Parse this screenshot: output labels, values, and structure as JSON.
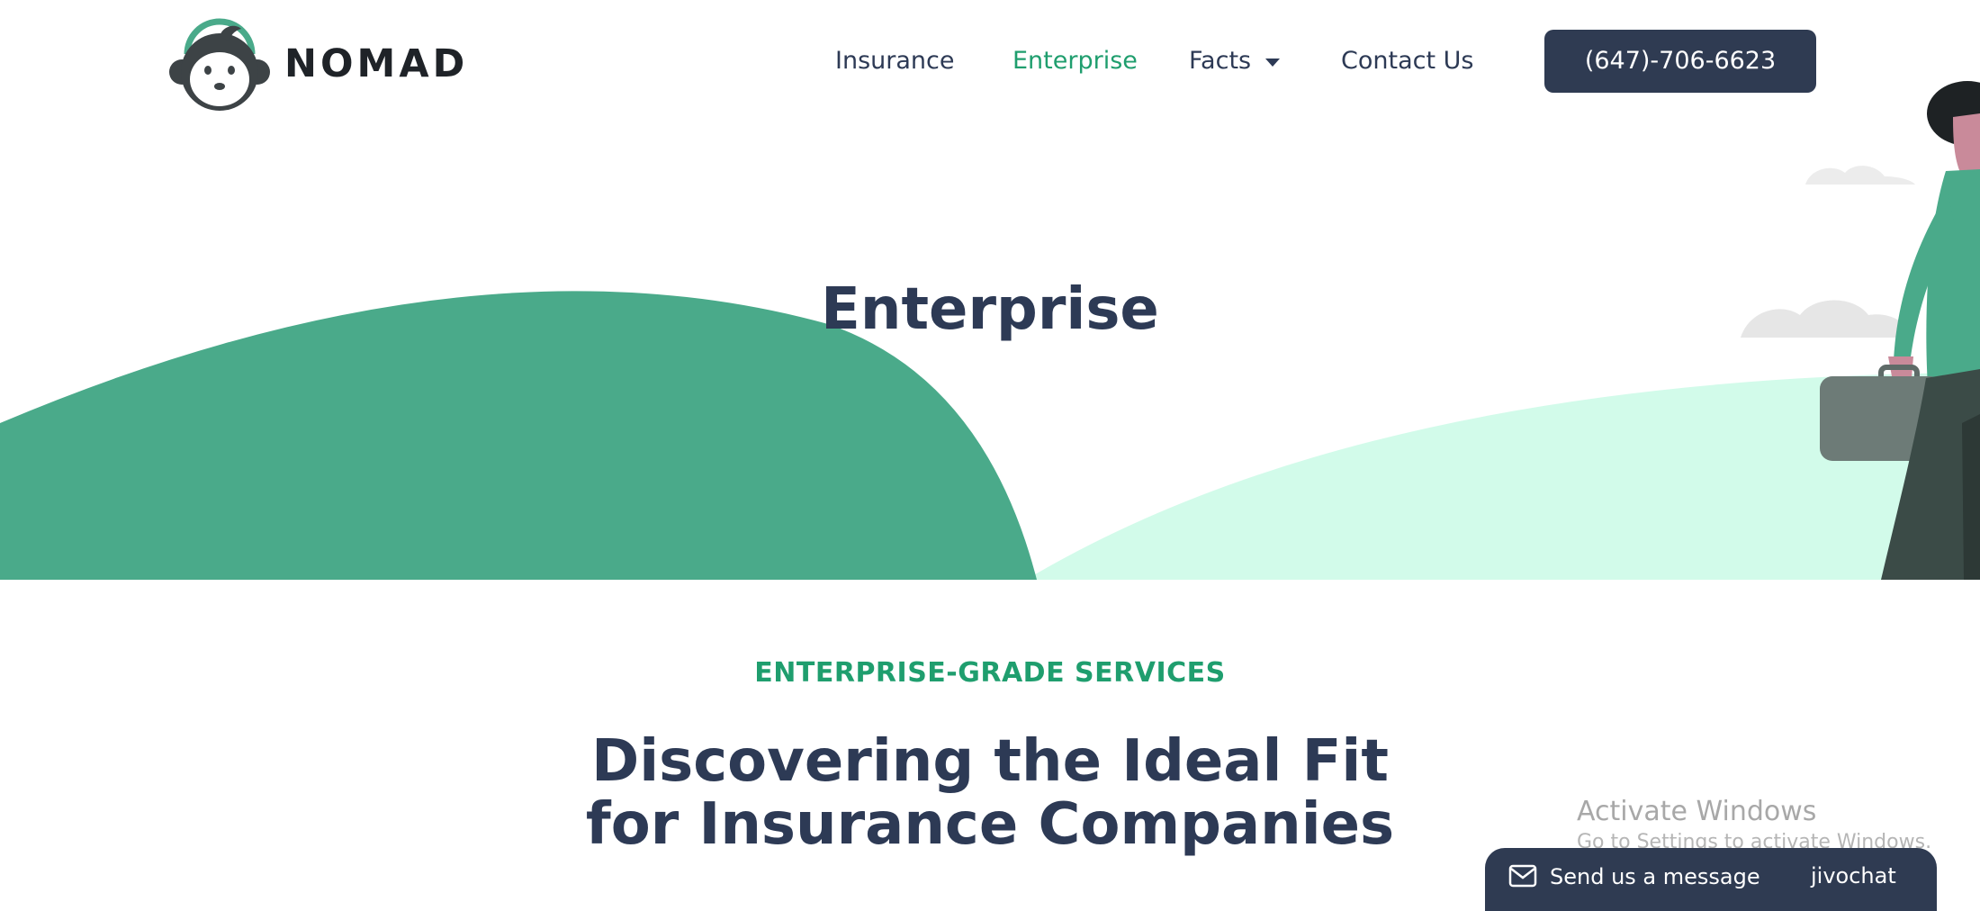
{
  "header": {
    "brand": "NOMAD",
    "nav": {
      "insurance": "Insurance",
      "enterprise": "Enterprise",
      "facts": "Facts",
      "contact": "Contact Us"
    },
    "phone": "(647)-706-6623"
  },
  "hero": {
    "title": "Enterprise"
  },
  "content": {
    "eyebrow": "ENTERPRISE-GRADE SERVICES",
    "heading_line1": "Discovering the Ideal Fit",
    "heading_line2": "for Insurance Companies"
  },
  "watermark": {
    "title": "Activate Windows",
    "subtitle": "Go to Settings to activate Windows."
  },
  "chat": {
    "label": "Send us a message",
    "brand": "jivochat"
  },
  "icons": [
    "nomad-monkey-logo",
    "chevron-down-icon",
    "mail-icon",
    "person-briefcase-illustration",
    "cloud-icon"
  ],
  "colors": {
    "accent_green": "#1f9e6e",
    "hill_dark": "#4aaa8a",
    "hill_light": "#d2fbea",
    "navy": "#2d3a55",
    "button_bg": "#2f3b52"
  }
}
